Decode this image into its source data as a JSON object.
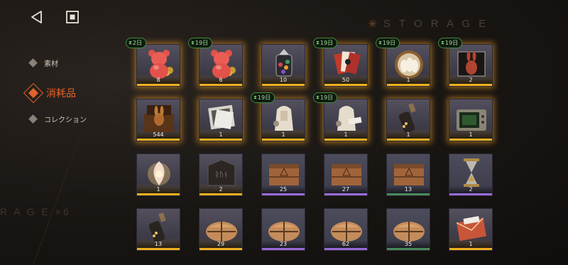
{
  "header": {
    "back_icon": "back-triangle-icon",
    "stop_icon": "stop-square-icon"
  },
  "decor": {
    "storage_label": "S T O R A G E",
    "storage_label2": "R A G E ×6"
  },
  "sidebar": {
    "items": [
      {
        "label": "素材",
        "active": false
      },
      {
        "label": "消耗品",
        "active": true
      },
      {
        "label": "コレクション",
        "active": false
      }
    ]
  },
  "colors": {
    "accent": "#e0632a",
    "bar_gold": "#f0b020",
    "bar_purple": "#9a6ad8",
    "bar_green": "#4a8a5a",
    "timer_green": "#3e8a3a"
  },
  "items": [
    {
      "name": "red-gummy-bear-gold",
      "count": "8",
      "timer": "2日",
      "bar": "gold"
    },
    {
      "name": "red-gummy-bear-gold",
      "count": "6",
      "timer": "19日",
      "bar": "gold"
    },
    {
      "name": "candy-jar",
      "count": "10",
      "timer": "",
      "bar": "gold"
    },
    {
      "name": "playing-cards",
      "count": "50",
      "timer": "19日",
      "bar": "gold"
    },
    {
      "name": "white-rabbit-chocolates",
      "count": "1",
      "timer": "19日",
      "bar": "gold"
    },
    {
      "name": "chocolate-rabbit-box",
      "count": "2",
      "timer": "19日",
      "bar": "gold"
    },
    {
      "name": "chocolate-rabbit-crate",
      "count": "544",
      "timer": "",
      "bar": "gold"
    },
    {
      "name": "photo-frame",
      "count": "1",
      "timer": "",
      "bar": "gold"
    },
    {
      "name": "sack-bundle",
      "count": "1",
      "timer": "19日",
      "bar": "gold"
    },
    {
      "name": "sack-bundle-tagged",
      "count": "1",
      "timer": "19日",
      "bar": "gold"
    },
    {
      "name": "bottle",
      "count": "1",
      "timer": "",
      "bar": "gold"
    },
    {
      "name": "tv-set",
      "count": "1",
      "timer": "",
      "bar": "gold"
    },
    {
      "name": "glowing-shell",
      "count": "1",
      "timer": "",
      "bar": "gold"
    },
    {
      "name": "rune-chest",
      "count": "2",
      "timer": "",
      "bar": "gold"
    },
    {
      "name": "wooden-crate",
      "count": "25",
      "timer": "",
      "bar": "purple"
    },
    {
      "name": "wooden-crate",
      "count": "27",
      "timer": "",
      "bar": "purple"
    },
    {
      "name": "wooden-crate",
      "count": "13",
      "timer": "",
      "bar": "green"
    },
    {
      "name": "hourglass",
      "count": "2",
      "timer": "",
      "bar": "purple"
    },
    {
      "name": "bottle",
      "count": "13",
      "timer": "",
      "bar": "gold"
    },
    {
      "name": "cloth-bundle",
      "count": "29",
      "timer": "",
      "bar": "gold"
    },
    {
      "name": "cloth-bundle",
      "count": "23",
      "timer": "",
      "bar": "purple"
    },
    {
      "name": "cloth-bundle",
      "count": "62",
      "timer": "",
      "bar": "purple"
    },
    {
      "name": "cloth-bundle",
      "count": "35",
      "timer": "",
      "bar": "green"
    },
    {
      "name": "envelope",
      "count": "1",
      "timer": "",
      "bar": "gold"
    }
  ]
}
